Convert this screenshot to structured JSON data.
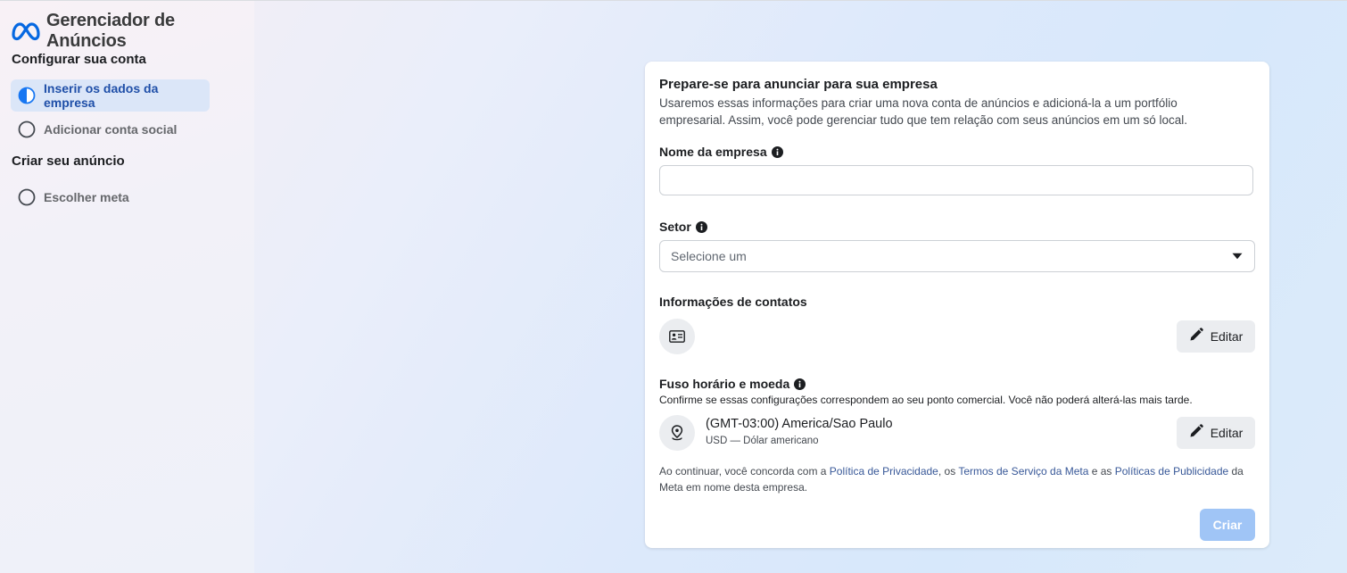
{
  "app": {
    "title": "Gerenciador de Anúncios",
    "brand_color": "#0668E1"
  },
  "sidebar": {
    "sections": [
      {
        "title": "Configurar sua conta",
        "steps": [
          {
            "label": "Inserir os dados da empresa",
            "state": "active"
          },
          {
            "label": "Adicionar conta social",
            "state": "pending"
          }
        ]
      },
      {
        "title": "Criar seu anúncio",
        "steps": [
          {
            "label": "Escolher meta",
            "state": "pending"
          }
        ]
      }
    ]
  },
  "form": {
    "title": "Prepare-se para anunciar para sua empresa",
    "description": "Usaremos essas informações para criar uma nova conta de anúncios e adicioná-la a um portfólio empresarial. Assim, você pode gerenciar tudo que tem relação com seus anúncios em um só local.",
    "company_name": {
      "label": "Nome da empresa",
      "value": "",
      "placeholder": ""
    },
    "sector": {
      "label": "Setor",
      "placeholder": "Selecione um"
    },
    "contact": {
      "label": "Informações de contatos",
      "edit_label": "Editar"
    },
    "timezone": {
      "label": "Fuso horário e moeda",
      "note": "Confirme se essas configurações correspondem ao seu ponto comercial. Você não poderá alterá-las mais tarde.",
      "zone": "(GMT-03:00) America/Sao Paulo",
      "currency": "USD — Dólar americano",
      "edit_label": "Editar"
    },
    "terms": {
      "part1": "Ao continuar, você concorda com a ",
      "link1": "Política de Privacidade",
      "part2": ", os ",
      "link2": "Termos de Serviço da Meta",
      "part3": " e as ",
      "link3": "Políticas de Publicidade",
      "part4": " da Meta em nome desta empresa."
    },
    "submit_label": "Criar",
    "submit_color": "#A0C5F6"
  },
  "icons": {
    "brand": "meta-logo-icon",
    "active_step": "half-filled-circle-icon",
    "pending_step": "empty-circle-icon",
    "info": "info-icon",
    "caret": "caret-down-icon",
    "contact_card": "id-card-icon",
    "location": "map-pin-icon",
    "edit": "pencil-icon"
  }
}
